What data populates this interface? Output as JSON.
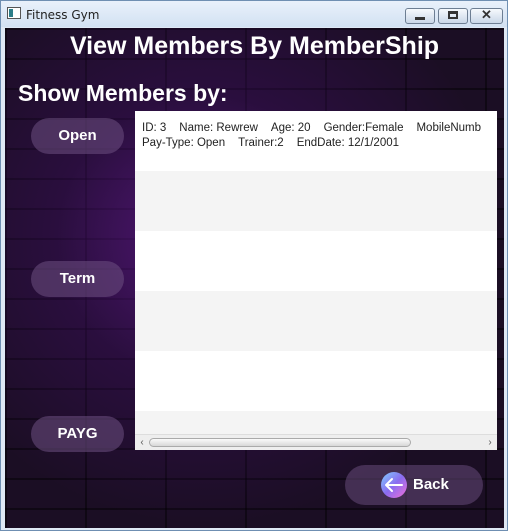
{
  "window": {
    "title": "Fitness Gym",
    "close_glyph": "✕"
  },
  "header": {
    "title": "View Members By MemberShip",
    "subtitle": "Show Members by:"
  },
  "filters": {
    "open": "Open",
    "term": "Term",
    "payg": "PAYG"
  },
  "members": [
    {
      "id": "ID: 3",
      "name": "Name: Rewrew",
      "age": "Age: 20",
      "gender": "Gender:Female",
      "mobile": "MobileNumb",
      "pay_type": "Pay-Type: Open",
      "trainer": "Trainer:2",
      "end_date": "EndDate: 12/1/2001"
    }
  ],
  "scrollbar": {
    "left_arrow": "‹",
    "right_arrow": "›"
  },
  "footer": {
    "back_label": "Back"
  },
  "colors": {
    "accent_gradient": [
      "#7fd0ff",
      "#8a6cf0",
      "#f06fd8"
    ],
    "background": "#1b0e24"
  }
}
